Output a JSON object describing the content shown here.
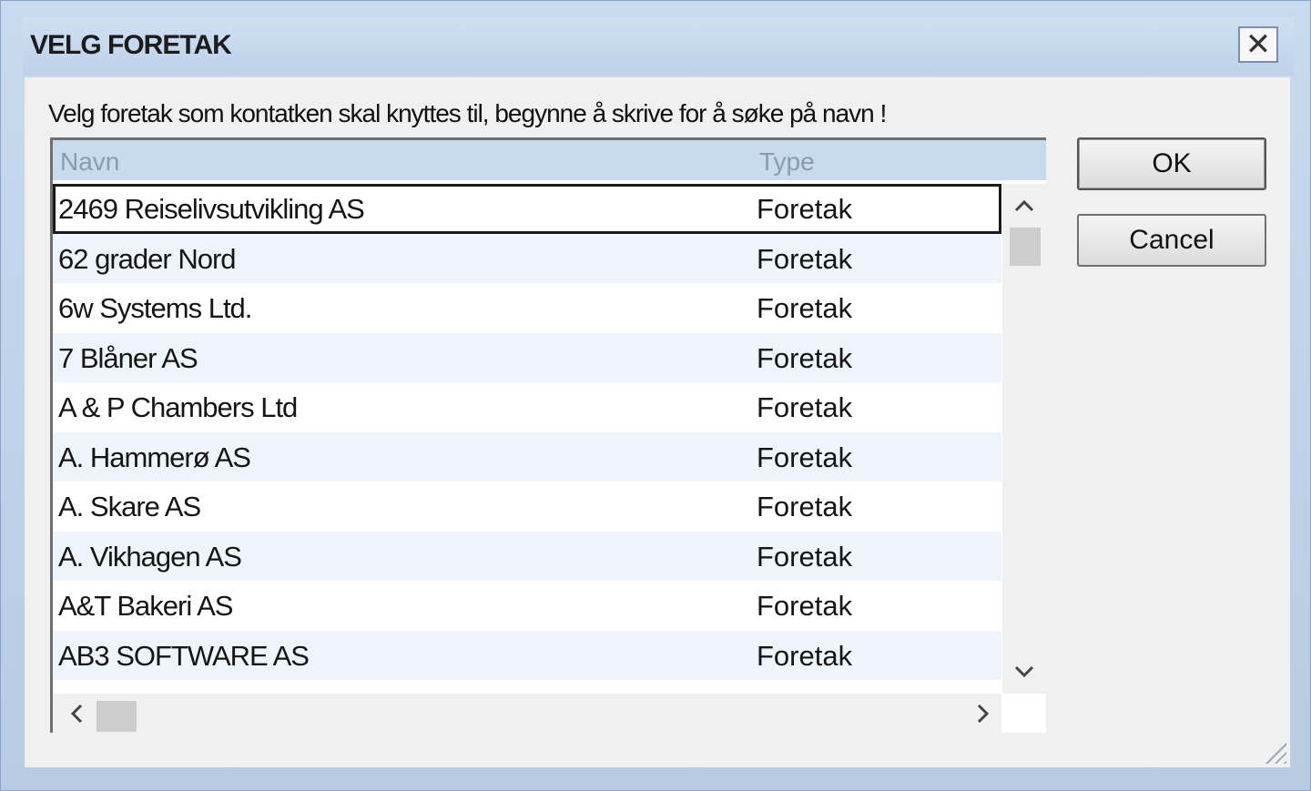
{
  "dialog": {
    "title": "VELG FORETAK",
    "close_glyph": "✕",
    "instruction": "Velg foretak som kontatken skal knyttes til, begynne å skrive for å søke på navn !"
  },
  "list": {
    "columns": {
      "name": "Navn",
      "type": "Type"
    },
    "rows": [
      {
        "name": "2469 Reiselivsutvikling AS",
        "type": "Foretak",
        "selected": true
      },
      {
        "name": "62 grader Nord",
        "type": "Foretak"
      },
      {
        "name": "6w Systems Ltd.",
        "type": "Foretak"
      },
      {
        "name": "7 Blåner AS",
        "type": "Foretak"
      },
      {
        "name": "A & P Chambers Ltd",
        "type": "Foretak"
      },
      {
        "name": "A. Hammerø AS",
        "type": "Foretak"
      },
      {
        "name": "A. Skare AS",
        "type": "Foretak"
      },
      {
        "name": "A. Vikhagen AS",
        "type": "Foretak"
      },
      {
        "name": "A&T Bakeri AS",
        "type": "Foretak"
      },
      {
        "name": "AB3 SOFTWARE AS",
        "type": "Foretak"
      }
    ]
  },
  "buttons": {
    "ok": "OK",
    "cancel": "Cancel"
  },
  "icons": {
    "scroll_up": "chevron-up-icon",
    "scroll_down": "chevron-down-icon",
    "scroll_left": "chevron-left-icon",
    "scroll_right": "chevron-right-icon",
    "resize_grip": "resize-grip-icon"
  },
  "colors": {
    "title_bar": "#c9daee",
    "header": "#c8daee",
    "row_alt": "#eef4fb",
    "client": "#f0f0f0"
  }
}
